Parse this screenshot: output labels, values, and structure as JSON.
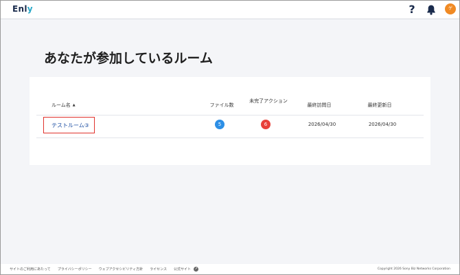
{
  "header": {
    "logo_main": "Enl",
    "logo_accent": "y",
    "help_glyph": "?",
    "avatar_initial": "ゲ"
  },
  "main": {
    "title": "あなたが参加しているルーム"
  },
  "table": {
    "columns": {
      "name": "ルーム名",
      "sort_glyph": "▲",
      "files": "ファイル数",
      "actions": "未完了アクション",
      "last_visit": "最終訪問日",
      "last_updated": "最終更新日"
    },
    "rows": [
      {
        "name": "テストルーム③",
        "files": "5",
        "actions": "6",
        "last_visit": "2026/04/30",
        "last_updated": "2026/04/30"
      }
    ]
  },
  "footer": {
    "links": [
      "サイトのご利用にあたって",
      "プライバシーポリシー",
      "ウェブアクセシビリティ方針",
      "ライセンス",
      "公式サイト"
    ],
    "ext_glyph": "↗",
    "copyright": "Copyright 2026 Sony Biz Networks Corporation"
  },
  "colors": {
    "files_badge": "#2d8fe6",
    "actions_badge": "#e8413a",
    "avatar": "#f08a24",
    "link": "#1e4fa3",
    "highlight_border": "#e0302a"
  },
  "icons": {
    "help": "help-icon",
    "bell": "bell-icon",
    "external": "external-link-icon"
  }
}
